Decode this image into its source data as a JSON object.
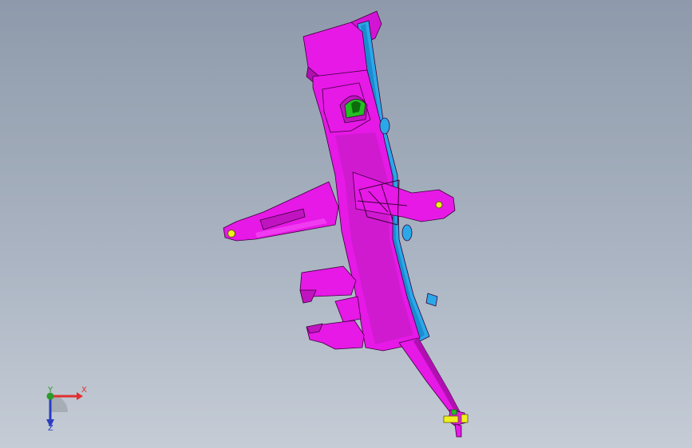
{
  "viewport": {
    "background_top": "#8e9aab",
    "background_bottom": "#c5ccd6"
  },
  "model": {
    "body_color": "#e619e6",
    "body_shadow": "#b010b0",
    "flange_color": "#2aa8e8",
    "detail_green": "#22c022",
    "detail_yellow": "#f0f020",
    "edge_color": "#3a003a"
  },
  "triad": {
    "x_label": "X",
    "y_label": "Y",
    "z_label": "Z",
    "x_color": "#e03030",
    "y_color": "#2a9a2a",
    "z_color": "#2a3cc0"
  }
}
